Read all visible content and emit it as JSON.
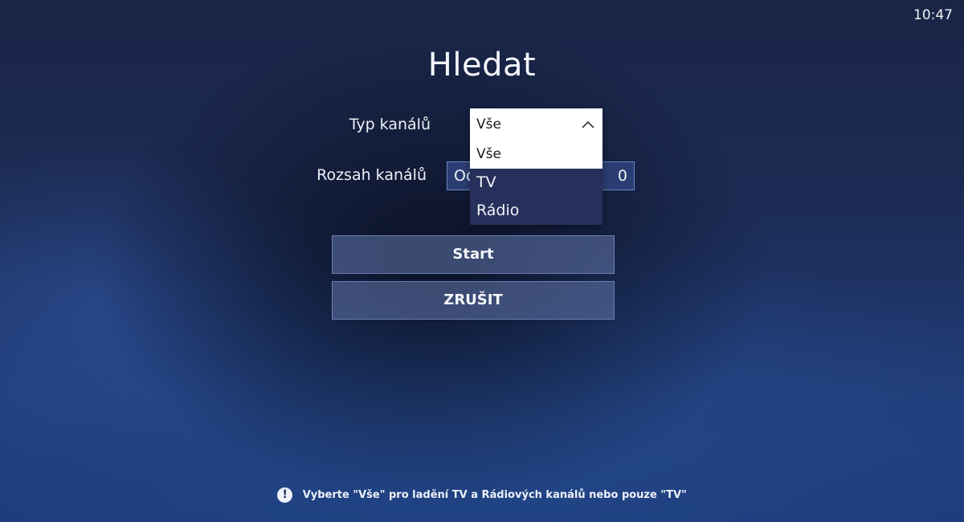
{
  "status_bar": {
    "time": "10:47"
  },
  "page": {
    "title": "Hledat"
  },
  "form": {
    "channel_type": {
      "label": "Typ kanálů",
      "selected": "Vše",
      "options": [
        "Vše",
        "TV",
        "Rádio"
      ],
      "highlighted_option": "Vše"
    },
    "channel_range": {
      "label": "Rozsah kanálů",
      "value_visible": "Od",
      "value_end_visible": "0"
    }
  },
  "buttons": {
    "start": "Start",
    "cancel": "ZRUŠIT"
  },
  "hint": {
    "icon": "!",
    "text": "Vyberte \"Vše\" pro ladění TV a Rádiových kanálů nebo pouze \"TV\""
  }
}
